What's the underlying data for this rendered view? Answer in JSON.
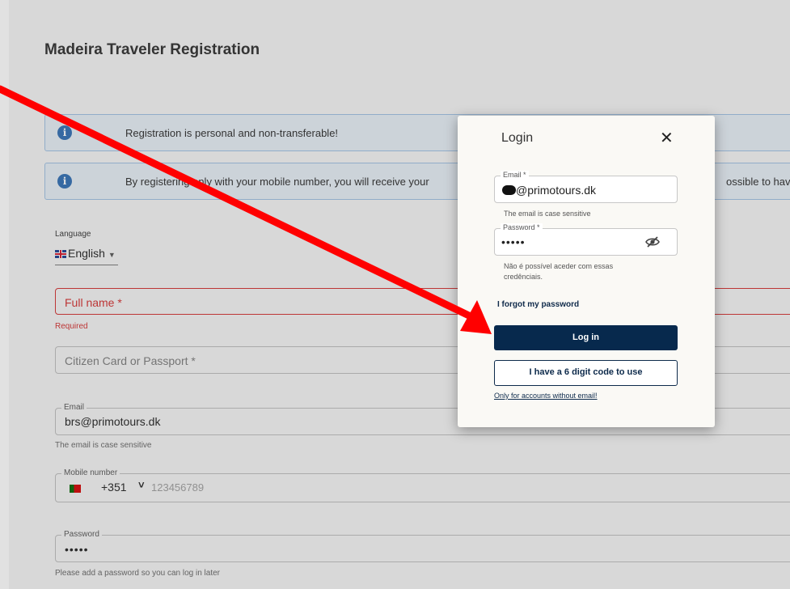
{
  "page": {
    "title": "Madeira Traveler Registration",
    "notices": [
      {
        "text": "Registration is personal and non-transferable!",
        "text_right": ""
      },
      {
        "text": "By registering only with your mobile number, you will receive your",
        "text_right": "ossible to hav"
      }
    ],
    "language": {
      "label": "Language",
      "value": "English"
    },
    "full_name": {
      "placeholder": "Full name *",
      "error": "Required"
    },
    "id_doc": {
      "placeholder": "Citizen Card or Passport *"
    },
    "email": {
      "label": "Email",
      "value": "brs@primotours.dk",
      "helper": "The email is case sensitive"
    },
    "mobile": {
      "label": "Mobile number",
      "country_code": "+351",
      "placeholder": "123456789"
    },
    "password": {
      "label": "Password",
      "value": "•••••",
      "helper": "Please add a password so you can log in later"
    }
  },
  "modal": {
    "title": "Login",
    "close": "✕",
    "email": {
      "label": "Email *",
      "value": "@primotours.dk",
      "helper": "The email is case sensitive"
    },
    "password": {
      "label": "Password *",
      "value": "•••••",
      "error_line1": "Não é possível aceder com essas",
      "error_line2": "credênciais."
    },
    "forgot": "I forgot my password",
    "login_button": "Log in",
    "code_button": "I have a 6 digit code to use",
    "code_note": "Only for accounts without email!"
  },
  "colors": {
    "primary": "#07294d",
    "error": "#d32f2f",
    "notice_bg": "#e6eef6",
    "annotation_arrow": "#ff0000"
  },
  "icons": {
    "info": "info-icon",
    "close": "close-icon",
    "eye": "eye-off-icon",
    "flag_uk": "uk-flag-icon",
    "flag_pt": "pt-flag-icon"
  }
}
